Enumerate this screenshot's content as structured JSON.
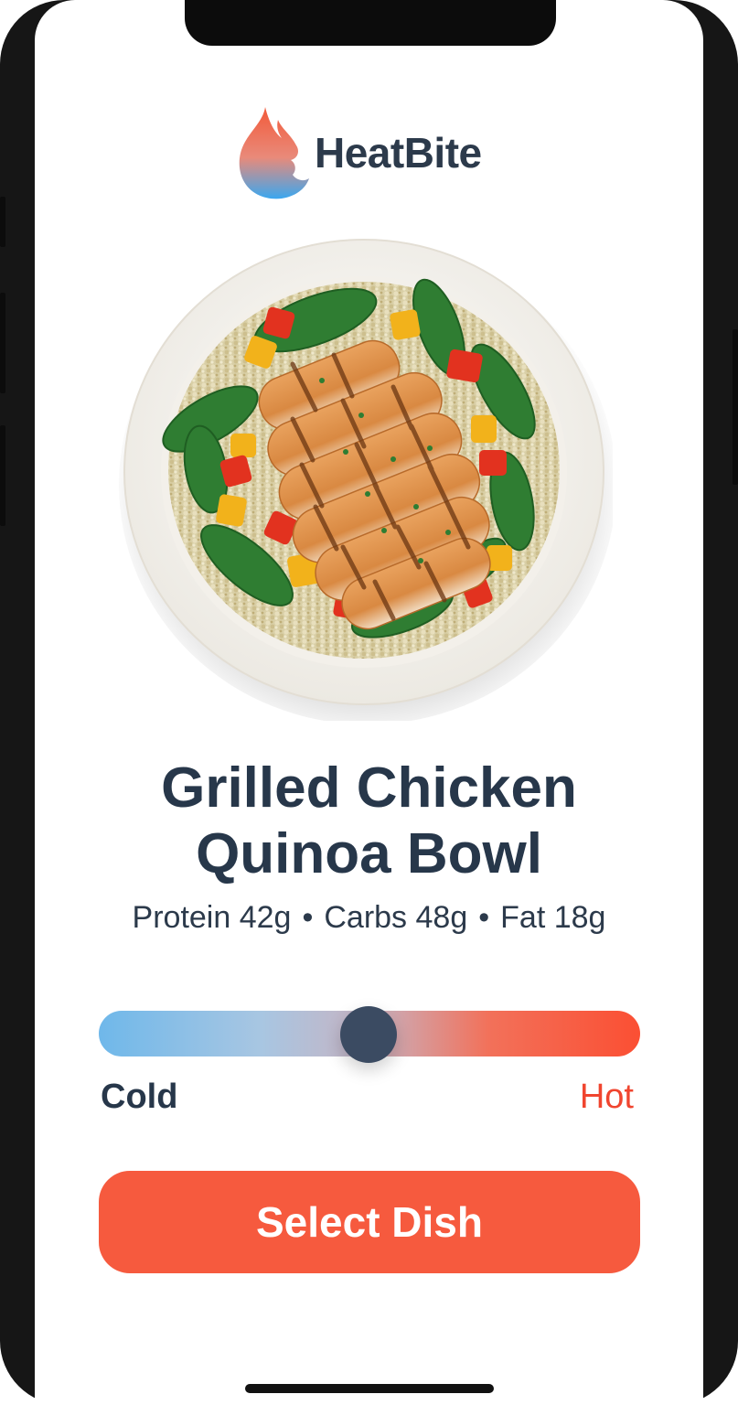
{
  "app": {
    "name": "HeatBite",
    "logo_icon": "flame-bite-icon"
  },
  "dish": {
    "title_line1": "Grilled Chicken",
    "title_line2": "Quinoa Bowl",
    "image_icon": "dish-photo",
    "macros": [
      {
        "label": "Protein 42g"
      },
      {
        "label": "Carbs 48g"
      },
      {
        "label": "Fat 18g"
      }
    ],
    "macro_separator": "•"
  },
  "temperature_slider": {
    "min_label": "Cold",
    "max_label": "Hot",
    "value_fraction": 0.5
  },
  "actions": {
    "select_label": "Select Dish"
  },
  "colors": {
    "accent": "#f65a3e",
    "hot": "#f0452f",
    "cold": "#6fb8ea",
    "text": "#27374a",
    "thumb": "#3b4b62"
  }
}
